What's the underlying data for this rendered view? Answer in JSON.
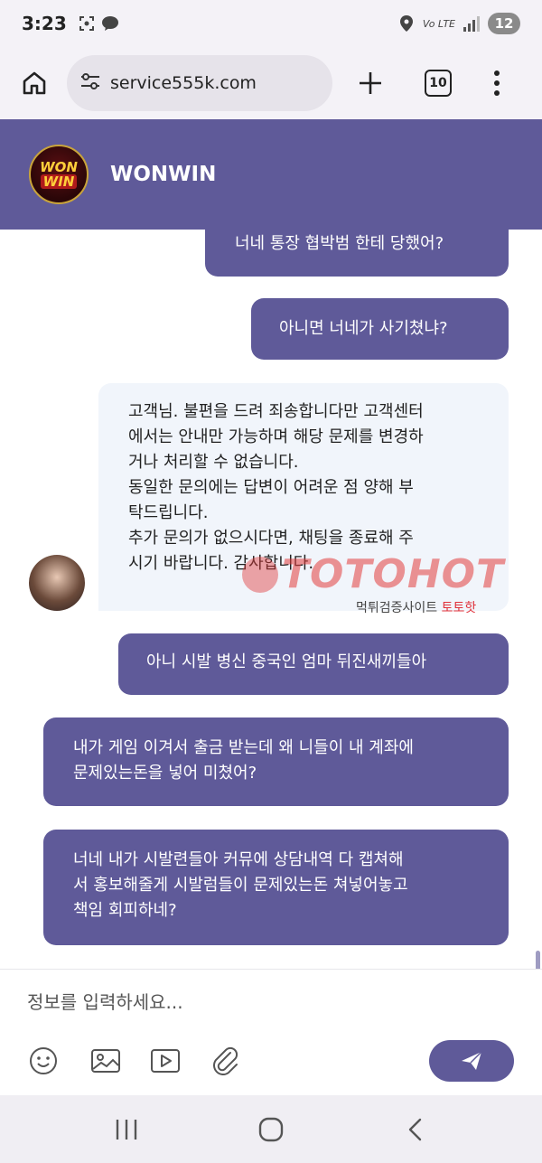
{
  "status_bar": {
    "time": "3:23",
    "network": "Vo LTE",
    "battery": "12"
  },
  "browser": {
    "url": "service555k.com",
    "tab_count": "10"
  },
  "chat_header": {
    "logo_top": "WON",
    "logo_bottom": "WIN",
    "title": "WONWIN"
  },
  "messages": [
    {
      "sender": "user",
      "lines": [
        "너네 통장 협박범 한테 당했어?"
      ]
    },
    {
      "sender": "user",
      "lines": [
        "아니면 너네가 사기쳤냐?"
      ]
    },
    {
      "sender": "agent",
      "lines": [
        "고객님. 불편을 드려 죄송합니다만 고객센터",
        "에서는 안내만 가능하며 해당 문제를 변경하",
        "거나 처리할 수 없습니다.",
        "동일한 문의에는 답변이 어려운 점 양해 부",
        "탁드립니다.",
        "추가 문의가 없으시다면, 채팅을 종료해 주",
        "시기 바랍니다. 감사합니다."
      ]
    },
    {
      "sender": "user",
      "lines": [
        "아니 시발 병신 중국인 엄마 뒤진새끼들아"
      ]
    },
    {
      "sender": "user",
      "lines": [
        "내가 게임 이겨서 출금 받는데 왜 니들이 내 계좌에",
        "문제있는돈을 넣어 미쳤어?"
      ]
    },
    {
      "sender": "user",
      "lines": [
        "너네 내가 시발련들아 커뮤에 상담내역 다 캡쳐해",
        "서 홍보해줄게 시발럼들이 문제있는돈 쳐넣어놓고",
        "책임 회피하네?"
      ]
    }
  ],
  "watermark": {
    "logo": "TOTOHOT",
    "subtitle_prefix": "먹튀검증사이트",
    "subtitle_brand": "토토핫"
  },
  "composer": {
    "placeholder": "정보를 입력하세요..."
  }
}
